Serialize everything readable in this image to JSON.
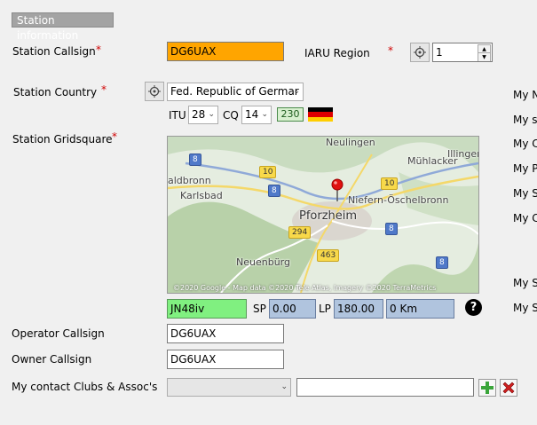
{
  "section": {
    "title": "Station information"
  },
  "station_callsign": {
    "label": "Station Callsign",
    "required": "*",
    "value": "DG6UAX"
  },
  "iaru_region": {
    "label": "IARU Region",
    "required": "*",
    "value": "1"
  },
  "station_country": {
    "label": "Station Country",
    "required": "*",
    "value": "Fed. Republic of Germar"
  },
  "itu": {
    "label": "ITU",
    "value": "28"
  },
  "cq": {
    "label": "CQ",
    "value": "14"
  },
  "dxcc": {
    "value": "230"
  },
  "gridsquare": {
    "label": "Station Gridsquare",
    "required": "*",
    "value": "JN48iv"
  },
  "map": {
    "labels": [
      "Neulingen",
      "Mühlacker",
      "Illingen",
      "aldbronn",
      "Karlsbad",
      "Niefern-Öschelbronn",
      "Pforzheim",
      "Neuenbürg"
    ],
    "badges": [
      "8",
      "10",
      "8",
      "10",
      "294",
      "8",
      "463",
      "8"
    ],
    "attribution": "©2020 Google - Map data ©2020 Tele Atlas, Imagery ©2020 TerraMetrics"
  },
  "sp": {
    "label": "SP",
    "value": "0.00"
  },
  "lp": {
    "label": "LP",
    "value": "180.00"
  },
  "distance": {
    "value": "0 Km"
  },
  "help": {
    "symbol": "?"
  },
  "operator_callsign": {
    "label": "Operator Callsign",
    "value": "DG6UAX"
  },
  "owner_callsign": {
    "label": "Owner Callsign",
    "value": "DG6UAX"
  },
  "clubs": {
    "label": "My contact Clubs & Assoc's",
    "select_value": "",
    "text_value": ""
  },
  "right_labels": [
    "My N",
    "My st",
    "My C",
    "My P",
    "My S",
    "My C",
    "My S",
    "My S"
  ],
  "colors": {
    "callsign_bg": "#ffa500",
    "grid_bg": "#80f080",
    "sp_bg": "#b0c4de",
    "required": "#d00000"
  },
  "icons": {
    "locate": "crosshair-icon",
    "add": "plus-icon",
    "delete": "x-icon",
    "help": "question-icon",
    "flag": "germany-flag-icon"
  }
}
